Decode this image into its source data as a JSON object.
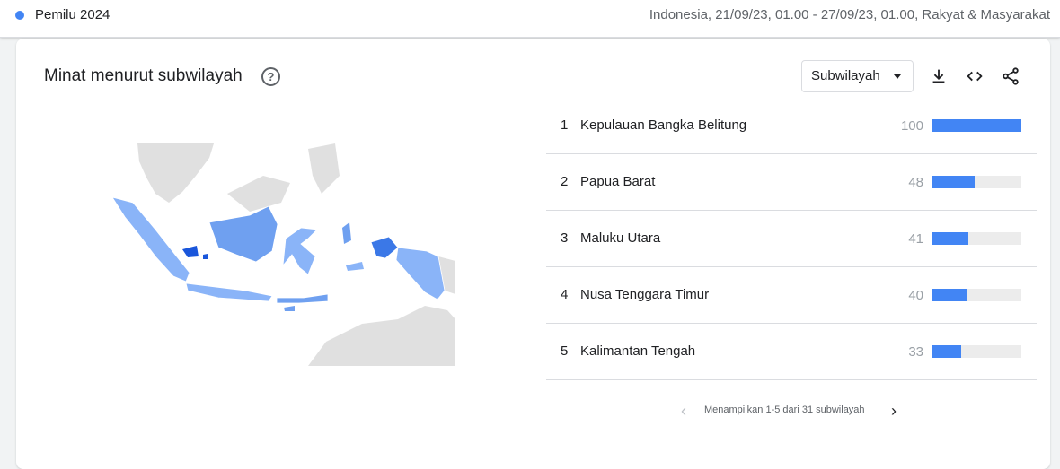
{
  "header": {
    "term": "Pemilu 2024",
    "term_color": "#4285f4",
    "context": "Indonesia, 21/09/23, 01.00 - 27/09/23, 01.00, Rakyat & Masyarakat"
  },
  "card": {
    "title": "Minat menurut subwilayah",
    "help_icon": "?",
    "select_value": "Subwilayah",
    "icons": [
      "download-icon",
      "embed-code-icon",
      "share-icon"
    ]
  },
  "regions": [
    {
      "rank": "1",
      "name": "Kepulauan Bangka Belitung",
      "value": "100"
    },
    {
      "rank": "2",
      "name": "Papua Barat",
      "value": "48"
    },
    {
      "rank": "3",
      "name": "Maluku Utara",
      "value": "41"
    },
    {
      "rank": "4",
      "name": "Nusa Tenggara Timur",
      "value": "40"
    },
    {
      "rank": "5",
      "name": "Kalimantan Tengah",
      "value": "33"
    }
  ],
  "pager": {
    "prev": "‹",
    "text": "Menampilkan 1-5 dari 31 subwilayah",
    "next": "›"
  },
  "colors": {
    "accent": "#4285f4",
    "map_light": "#8ab4f8",
    "map_mid": "#6fa0f0",
    "map_dark": "#1a56db",
    "map_land": "#e0e0e0"
  }
}
